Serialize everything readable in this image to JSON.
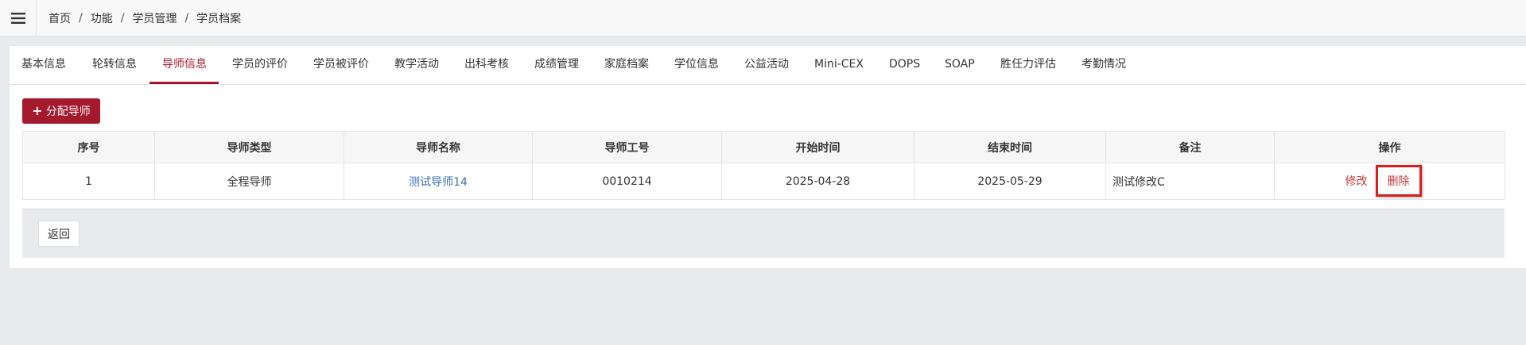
{
  "breadcrumb": [
    "首页",
    "功能",
    "学员管理",
    "学员档案"
  ],
  "breadcrumb_separator": "/",
  "tabs": [
    {
      "label": "基本信息",
      "active": false
    },
    {
      "label": "轮转信息",
      "active": false
    },
    {
      "label": "导师信息",
      "active": true
    },
    {
      "label": "学员的评价",
      "active": false
    },
    {
      "label": "学员被评价",
      "active": false
    },
    {
      "label": "教学活动",
      "active": false
    },
    {
      "label": "出科考核",
      "active": false
    },
    {
      "label": "成绩管理",
      "active": false
    },
    {
      "label": "家庭档案",
      "active": false
    },
    {
      "label": "学位信息",
      "active": false
    },
    {
      "label": "公益活动",
      "active": false
    },
    {
      "label": "Mini-CEX",
      "active": false
    },
    {
      "label": "DOPS",
      "active": false
    },
    {
      "label": "SOAP",
      "active": false
    },
    {
      "label": "胜任力评估",
      "active": false
    },
    {
      "label": "考勤情况",
      "active": false
    }
  ],
  "toolbar": {
    "assign_label": "分配导师"
  },
  "table": {
    "headers": [
      "序号",
      "导师类型",
      "导师名称",
      "导师工号",
      "开始时间",
      "结束时间",
      "备注",
      "操作"
    ],
    "rows": [
      {
        "index": "1",
        "type": "全程导师",
        "name": "测试导师14",
        "code": "0010214",
        "start": "2025-04-28",
        "end": "2025-05-29",
        "note": "测试修改C",
        "edit_label": "修改",
        "delete_label": "删除"
      }
    ]
  },
  "footer": {
    "back_label": "返回"
  },
  "colors": {
    "accent": "#a8192f",
    "link": "#3c6fb3",
    "highlight_box": "#d81e1e"
  },
  "icons": {
    "menu": "hamburger-icon",
    "assign": "plus-icon"
  }
}
